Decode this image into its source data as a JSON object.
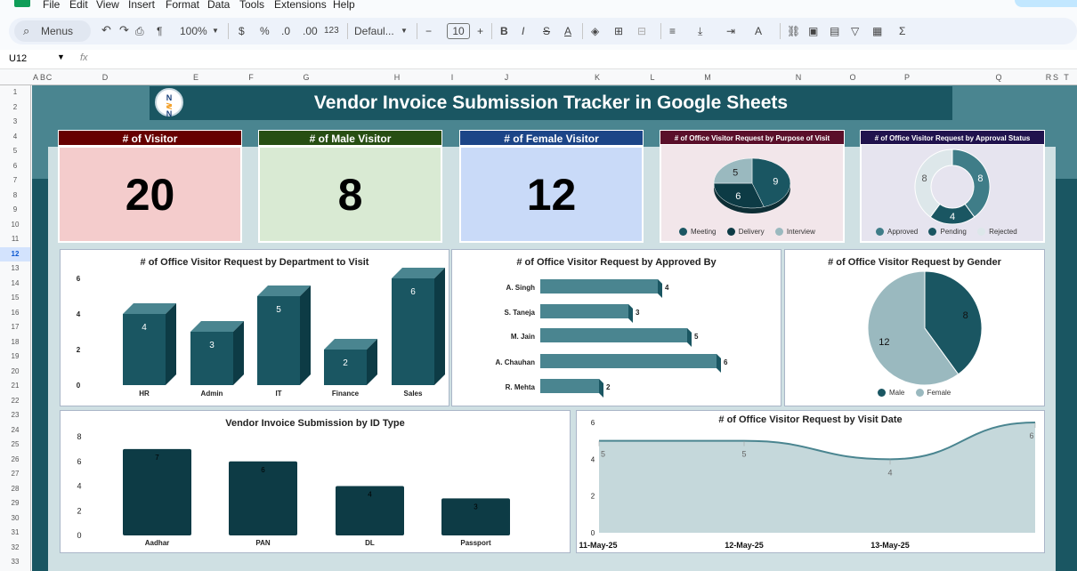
{
  "menubar": {
    "items": [
      "File",
      "Edit",
      "View",
      "Insert",
      "Format",
      "Data",
      "Tools",
      "Extensions",
      "Help"
    ]
  },
  "toolbar": {
    "search_label": "Menus",
    "zoom": "100%",
    "currency": "$",
    "percent": "%",
    "dec_less": ".0",
    "dec_more": ".00",
    "format_123": "123",
    "font": "Defaul...",
    "font_size": "10",
    "bold": "B",
    "italic": "I",
    "strike": "S",
    "text_color": "A",
    "sigma": "Σ"
  },
  "formula_bar": {
    "cell_ref": "U12",
    "fx": "fx"
  },
  "columns": [
    "A",
    "B",
    "C",
    "D",
    "E",
    "F",
    "G",
    "H",
    "I",
    "J",
    "K",
    "L",
    "M",
    "N",
    "O",
    "P",
    "Q",
    "R",
    "S",
    "T"
  ],
  "rows": [
    "1",
    "2",
    "3",
    "4",
    "5",
    "6",
    "7",
    "8",
    "9",
    "10",
    "11",
    "12",
    "13",
    "14",
    "15",
    "16",
    "17",
    "18",
    "19",
    "20",
    "21",
    "22",
    "23",
    "24",
    "25",
    "26",
    "27",
    "28",
    "29",
    "30",
    "31",
    "32",
    "33"
  ],
  "selected_row": "12",
  "dashboard": {
    "title": "Vendor Invoice Submission Tracker in Google Sheets",
    "logo_text": "N"
  },
  "kpis": [
    {
      "label": "# of Visitor",
      "value": "20",
      "head_color": "#660000",
      "body_color": "#f4cccc"
    },
    {
      "label": "# of Male Visitor",
      "value": "8",
      "head_color": "#274e13",
      "body_color": "#d9ead3"
    },
    {
      "label": "# of Female Visitor",
      "value": "12",
      "head_color": "#1c4587",
      "body_color": "#c9daf8"
    }
  ],
  "purpose_chart": {
    "title": "# of Office Visitor Request by Purpose of Visit",
    "legend": [
      "Meeting",
      "Delivery",
      "Interview"
    ],
    "colors": [
      "#1a5662",
      "#0d3b45",
      "#9ab9bf"
    ]
  },
  "approval_chart": {
    "title": "# of Office Visitor Request by Approval Status",
    "legend": [
      "Approved",
      "Pending",
      "Rejected"
    ],
    "colors": [
      "#3f7d88",
      "#1a5662",
      "#dde7ea"
    ]
  },
  "department_chart": {
    "title": "# of Office Visitor Request by Department to Visit"
  },
  "approvedby_chart": {
    "title": "# of Office Visitor Request by Approved By"
  },
  "gender_chart": {
    "title": "# of Office Visitor Request by Gender",
    "legend": [
      "Male",
      "Female"
    ],
    "colors": [
      "#1a5662",
      "#9ab9bf"
    ]
  },
  "idtype_chart": {
    "title": "Vendor Invoice Submission by ID Type"
  },
  "visitdate_chart": {
    "title": "# of Office Visitor Request by Visit Date"
  },
  "chart_data": [
    {
      "type": "pie",
      "title": "# of Office Visitor Request by Purpose of Visit",
      "categories": [
        "Meeting",
        "Delivery",
        "Interview"
      ],
      "values": [
        9,
        6,
        5
      ]
    },
    {
      "type": "pie",
      "title": "# of Office Visitor Request by Approval Status",
      "categories": [
        "Approved",
        "Pending",
        "Rejected"
      ],
      "values": [
        8,
        4,
        8
      ]
    },
    {
      "type": "bar",
      "title": "# of Office Visitor Request by Department to Visit",
      "categories": [
        "HR",
        "Admin",
        "IT",
        "Finance",
        "Sales"
      ],
      "values": [
        4,
        3,
        5,
        2,
        6
      ],
      "ylim": [
        0,
        6
      ],
      "yticks": [
        0,
        2,
        4,
        6
      ]
    },
    {
      "type": "bar",
      "orientation": "horizontal",
      "title": "# of Office Visitor Request by Approved By",
      "categories": [
        "A. Singh",
        "S. Taneja",
        "M. Jain",
        "A. Chauhan",
        "R. Mehta"
      ],
      "values": [
        4,
        3,
        5,
        6,
        2
      ]
    },
    {
      "type": "pie",
      "title": "# of Office Visitor Request by Gender",
      "categories": [
        "Male",
        "Female"
      ],
      "values": [
        8,
        12
      ]
    },
    {
      "type": "bar",
      "title": "Vendor Invoice Submission by ID Type",
      "categories": [
        "Aadhar",
        "PAN",
        "DL",
        "Passport"
      ],
      "values": [
        7,
        6,
        4,
        3
      ],
      "ylim": [
        0,
        8
      ],
      "yticks": [
        0,
        2,
        4,
        6,
        8
      ]
    },
    {
      "type": "area",
      "title": "# of Office Visitor Request by Visit Date",
      "x": [
        "11-May-25",
        "12-May-25",
        "13-May-25"
      ],
      "points": [
        5,
        5,
        4,
        6
      ],
      "ylim": [
        0,
        6
      ],
      "yticks": [
        0,
        2,
        4,
        6
      ]
    }
  ]
}
